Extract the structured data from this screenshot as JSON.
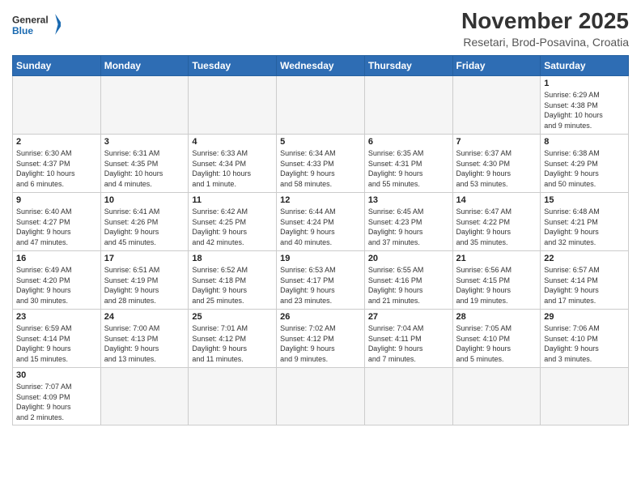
{
  "header": {
    "logo_general": "General",
    "logo_blue": "Blue",
    "month_year": "November 2025",
    "location": "Resetari, Brod-Posavina, Croatia"
  },
  "weekdays": [
    "Sunday",
    "Monday",
    "Tuesday",
    "Wednesday",
    "Thursday",
    "Friday",
    "Saturday"
  ],
  "weeks": [
    [
      {
        "day": "",
        "info": ""
      },
      {
        "day": "",
        "info": ""
      },
      {
        "day": "",
        "info": ""
      },
      {
        "day": "",
        "info": ""
      },
      {
        "day": "",
        "info": ""
      },
      {
        "day": "",
        "info": ""
      },
      {
        "day": "1",
        "info": "Sunrise: 6:29 AM\nSunset: 4:38 PM\nDaylight: 10 hours\nand 9 minutes."
      }
    ],
    [
      {
        "day": "2",
        "info": "Sunrise: 6:30 AM\nSunset: 4:37 PM\nDaylight: 10 hours\nand 6 minutes."
      },
      {
        "day": "3",
        "info": "Sunrise: 6:31 AM\nSunset: 4:35 PM\nDaylight: 10 hours\nand 4 minutes."
      },
      {
        "day": "4",
        "info": "Sunrise: 6:33 AM\nSunset: 4:34 PM\nDaylight: 10 hours\nand 1 minute."
      },
      {
        "day": "5",
        "info": "Sunrise: 6:34 AM\nSunset: 4:33 PM\nDaylight: 9 hours\nand 58 minutes."
      },
      {
        "day": "6",
        "info": "Sunrise: 6:35 AM\nSunset: 4:31 PM\nDaylight: 9 hours\nand 55 minutes."
      },
      {
        "day": "7",
        "info": "Sunrise: 6:37 AM\nSunset: 4:30 PM\nDaylight: 9 hours\nand 53 minutes."
      },
      {
        "day": "8",
        "info": "Sunrise: 6:38 AM\nSunset: 4:29 PM\nDaylight: 9 hours\nand 50 minutes."
      }
    ],
    [
      {
        "day": "9",
        "info": "Sunrise: 6:40 AM\nSunset: 4:27 PM\nDaylight: 9 hours\nand 47 minutes."
      },
      {
        "day": "10",
        "info": "Sunrise: 6:41 AM\nSunset: 4:26 PM\nDaylight: 9 hours\nand 45 minutes."
      },
      {
        "day": "11",
        "info": "Sunrise: 6:42 AM\nSunset: 4:25 PM\nDaylight: 9 hours\nand 42 minutes."
      },
      {
        "day": "12",
        "info": "Sunrise: 6:44 AM\nSunset: 4:24 PM\nDaylight: 9 hours\nand 40 minutes."
      },
      {
        "day": "13",
        "info": "Sunrise: 6:45 AM\nSunset: 4:23 PM\nDaylight: 9 hours\nand 37 minutes."
      },
      {
        "day": "14",
        "info": "Sunrise: 6:47 AM\nSunset: 4:22 PM\nDaylight: 9 hours\nand 35 minutes."
      },
      {
        "day": "15",
        "info": "Sunrise: 6:48 AM\nSunset: 4:21 PM\nDaylight: 9 hours\nand 32 minutes."
      }
    ],
    [
      {
        "day": "16",
        "info": "Sunrise: 6:49 AM\nSunset: 4:20 PM\nDaylight: 9 hours\nand 30 minutes."
      },
      {
        "day": "17",
        "info": "Sunrise: 6:51 AM\nSunset: 4:19 PM\nDaylight: 9 hours\nand 28 minutes."
      },
      {
        "day": "18",
        "info": "Sunrise: 6:52 AM\nSunset: 4:18 PM\nDaylight: 9 hours\nand 25 minutes."
      },
      {
        "day": "19",
        "info": "Sunrise: 6:53 AM\nSunset: 4:17 PM\nDaylight: 9 hours\nand 23 minutes."
      },
      {
        "day": "20",
        "info": "Sunrise: 6:55 AM\nSunset: 4:16 PM\nDaylight: 9 hours\nand 21 minutes."
      },
      {
        "day": "21",
        "info": "Sunrise: 6:56 AM\nSunset: 4:15 PM\nDaylight: 9 hours\nand 19 minutes."
      },
      {
        "day": "22",
        "info": "Sunrise: 6:57 AM\nSunset: 4:14 PM\nDaylight: 9 hours\nand 17 minutes."
      }
    ],
    [
      {
        "day": "23",
        "info": "Sunrise: 6:59 AM\nSunset: 4:14 PM\nDaylight: 9 hours\nand 15 minutes."
      },
      {
        "day": "24",
        "info": "Sunrise: 7:00 AM\nSunset: 4:13 PM\nDaylight: 9 hours\nand 13 minutes."
      },
      {
        "day": "25",
        "info": "Sunrise: 7:01 AM\nSunset: 4:12 PM\nDaylight: 9 hours\nand 11 minutes."
      },
      {
        "day": "26",
        "info": "Sunrise: 7:02 AM\nSunset: 4:12 PM\nDaylight: 9 hours\nand 9 minutes."
      },
      {
        "day": "27",
        "info": "Sunrise: 7:04 AM\nSunset: 4:11 PM\nDaylight: 9 hours\nand 7 minutes."
      },
      {
        "day": "28",
        "info": "Sunrise: 7:05 AM\nSunset: 4:10 PM\nDaylight: 9 hours\nand 5 minutes."
      },
      {
        "day": "29",
        "info": "Sunrise: 7:06 AM\nSunset: 4:10 PM\nDaylight: 9 hours\nand 3 minutes."
      }
    ],
    [
      {
        "day": "30",
        "info": "Sunrise: 7:07 AM\nSunset: 4:09 PM\nDaylight: 9 hours\nand 2 minutes."
      },
      {
        "day": "",
        "info": ""
      },
      {
        "day": "",
        "info": ""
      },
      {
        "day": "",
        "info": ""
      },
      {
        "day": "",
        "info": ""
      },
      {
        "day": "",
        "info": ""
      },
      {
        "day": "",
        "info": ""
      }
    ]
  ]
}
